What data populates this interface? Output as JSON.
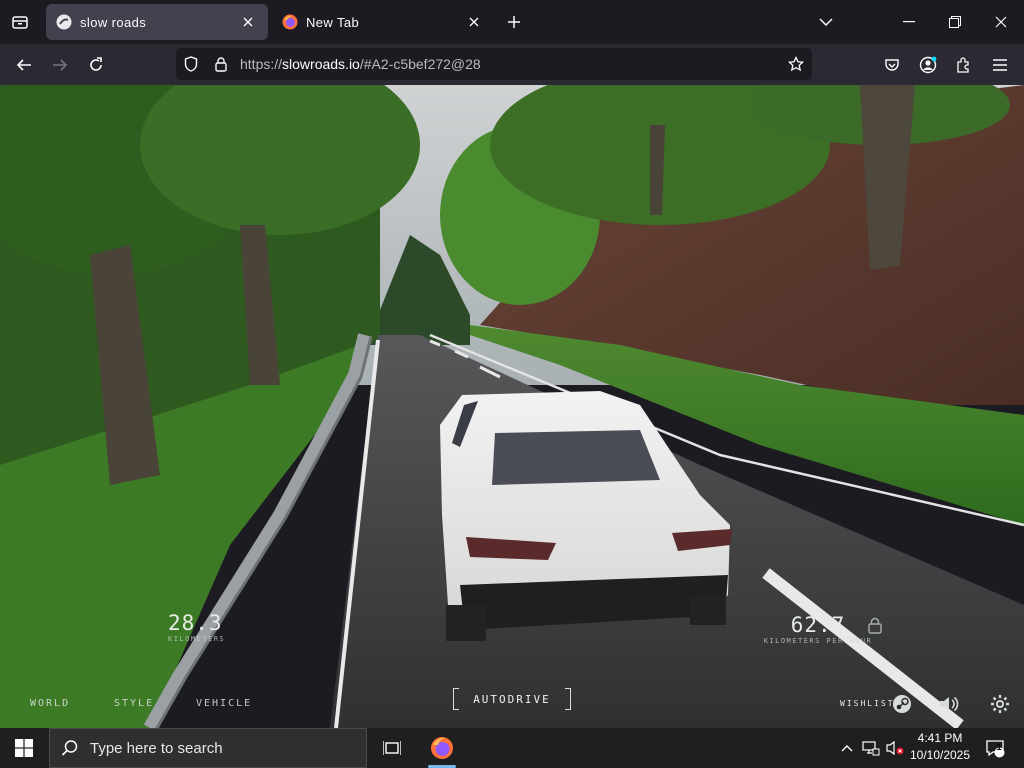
{
  "browser": {
    "tabs": [
      {
        "title": "slow roads",
        "active": true,
        "favicon": "slow-roads-favicon"
      },
      {
        "title": "New Tab",
        "active": false,
        "favicon": "firefox-favicon"
      }
    ],
    "url": {
      "scheme": "https://",
      "host": "slowroads.io",
      "rest": "/#A2-c5bef272@28"
    },
    "icons": [
      "tab-overview-icon",
      "close-icon",
      "plus-icon",
      "chevron-down-icon",
      "minimize-icon",
      "maximize-icon",
      "window-close-icon",
      "back-arrow-icon",
      "forward-arrow-icon",
      "reload-icon",
      "shield-icon",
      "lock-icon",
      "star-icon",
      "pocket-icon",
      "account-icon",
      "extensions-icon",
      "menu-icon"
    ]
  },
  "game": {
    "distance": {
      "value": "28.3",
      "unit": "KILOMETERS"
    },
    "speed": {
      "value": "62.7",
      "unit": "KILOMETERS PER HOUR"
    },
    "menu": {
      "world": "WORLD",
      "style": "STYLE",
      "vehicle": "VEHICLE"
    },
    "autodrive_label": "AUTODRIVE",
    "wishlist_label": "WISHLIST",
    "icons": [
      "lock-icon",
      "steam-icon",
      "speaker-icon",
      "gear-icon"
    ]
  },
  "taskbar": {
    "search_placeholder": "Type here to search",
    "time": "4:41 PM",
    "date": "10/10/2025",
    "notification_count": "1",
    "accent": "#76b9ed"
  }
}
